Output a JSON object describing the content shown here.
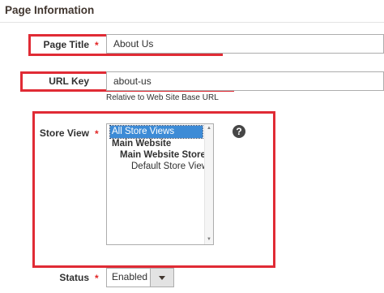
{
  "section": {
    "title": "Page Information"
  },
  "fields": {
    "page_title": {
      "label": "Page Title",
      "required_mark": "*",
      "value": "About Us"
    },
    "url_key": {
      "label": "URL Key",
      "value": "about-us",
      "note": "Relative to Web Site Base URL"
    },
    "store_view": {
      "label": "Store View",
      "required_mark": "*",
      "options": [
        "All Store Views",
        "Main Website",
        "Main Website Store",
        "Default Store View"
      ],
      "selected": "All Store Views",
      "help_icon": "question-circle-icon",
      "help_glyph": "?"
    },
    "status": {
      "label": "Status",
      "required_mark": "*",
      "value": "Enabled"
    }
  },
  "colors": {
    "highlight_box": "#e02b35",
    "required": "#e22626",
    "selection": "#3d8bd6"
  }
}
